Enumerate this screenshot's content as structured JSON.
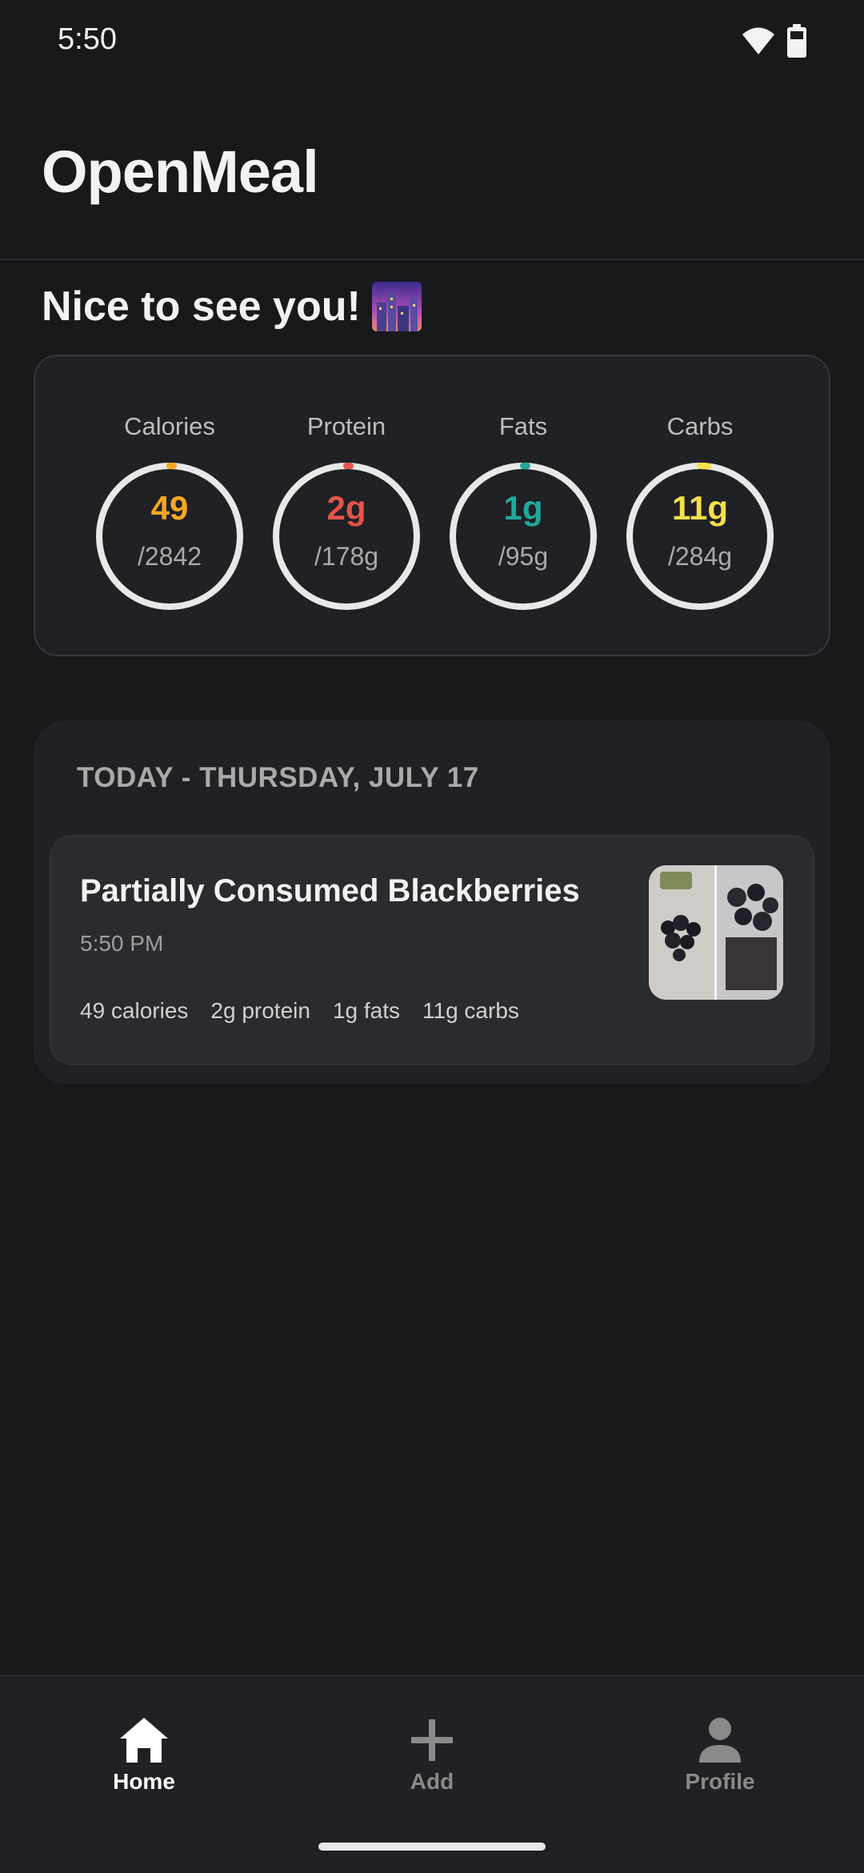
{
  "status_bar": {
    "time": "5:50",
    "wifi_icon": "wifi-icon",
    "battery_icon": "battery-icon"
  },
  "header": {
    "app_title": "OpenMeal"
  },
  "greeting": {
    "text": "Nice to see you!",
    "icon": "night-city-emoji"
  },
  "macros": [
    {
      "label": "Calories",
      "value": "49",
      "goal": "/2842",
      "color": "#f5a623",
      "progress": 0.017
    },
    {
      "label": "Protein",
      "value": "2g",
      "goal": "/178g",
      "color": "#e5534b",
      "progress": 0.011
    },
    {
      "label": "Fats",
      "value": "1g",
      "goal": "/95g",
      "color": "#20a89a",
      "progress": 0.011
    },
    {
      "label": "Carbs",
      "value": "11g",
      "goal": "/284g",
      "color": "#f4e04d",
      "progress": 0.039
    }
  ],
  "today": {
    "heading": "TODAY - THURSDAY, JULY 17",
    "meals": [
      {
        "name": "Partially Consumed Blackberries",
        "time": "5:50 PM",
        "calories": "49 calories",
        "protein": "2g protein",
        "fats": "1g fats",
        "carbs": "11g carbs"
      }
    ]
  },
  "nav": [
    {
      "label": "Home",
      "icon": "home-icon",
      "active": true
    },
    {
      "label": "Add",
      "icon": "plus-icon",
      "active": false
    },
    {
      "label": "Profile",
      "icon": "person-icon",
      "active": false
    }
  ]
}
